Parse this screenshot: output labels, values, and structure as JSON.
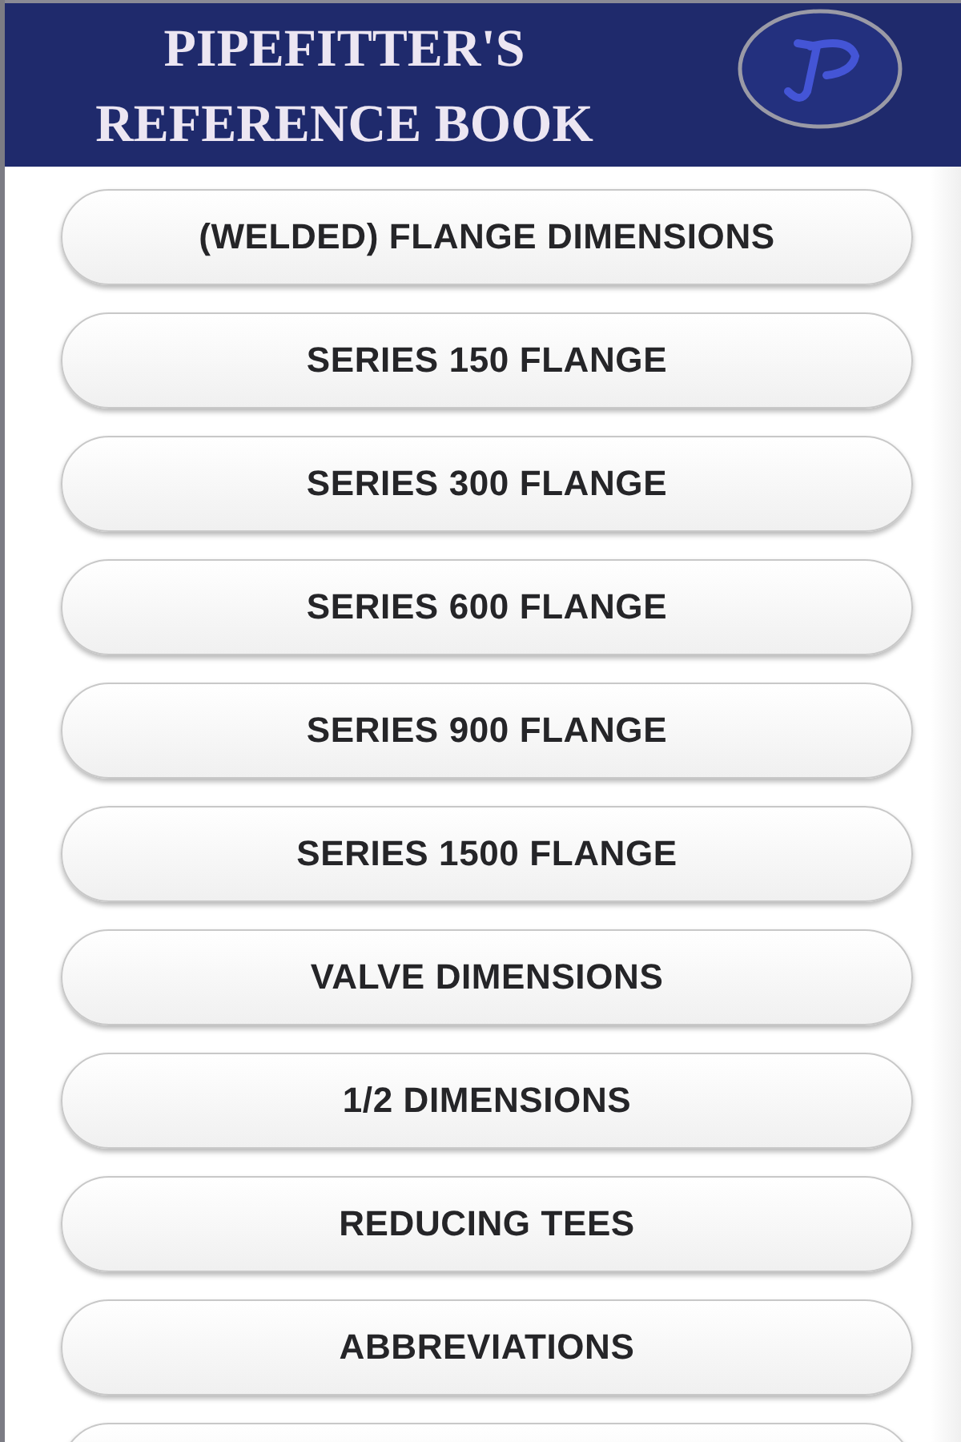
{
  "header": {
    "title": "PIPEFITTER'S REFERENCE BOOK"
  },
  "menu": {
    "buttons": [
      {
        "label": "(WELDED) FLANGE DIMENSIONS"
      },
      {
        "label": "SERIES 150 FLANGE"
      },
      {
        "label": "SERIES 300 FLANGE"
      },
      {
        "label": "SERIES 600 FLANGE"
      },
      {
        "label": "SERIES 900 FLANGE"
      },
      {
        "label": "SERIES 1500 FLANGE"
      },
      {
        "label": "VALVE DIMENSIONS"
      },
      {
        "label": "1/2 DIMENSIONS"
      },
      {
        "label": "REDUCING TEES"
      },
      {
        "label": "ABBREVIATIONS"
      }
    ],
    "more_below": true
  }
}
